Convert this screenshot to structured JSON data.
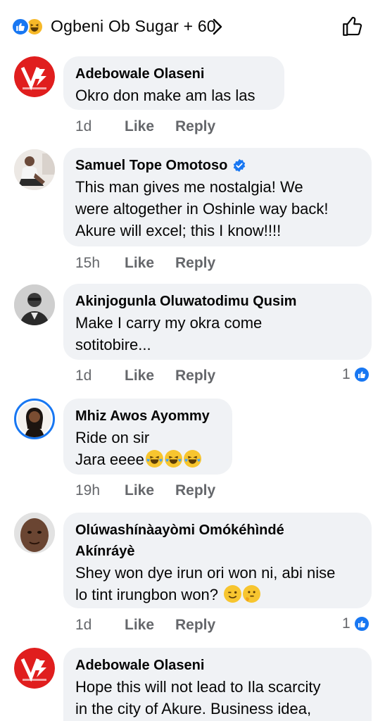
{
  "header": {
    "title": "Ogbeni Ob Sugar + 60",
    "reaction_icons": [
      "like-icon",
      "haha-icon"
    ],
    "chevron_icon": "chevron-right-icon",
    "action_icon": "thumbs-up-outline-icon"
  },
  "colors": {
    "accent": "#1877f2",
    "bubble": "#f0f2f5",
    "secondary_text": "#65676b",
    "emoji_yellow": "#f7c52f"
  },
  "comments": [
    {
      "author": "Adebowale Olaseni",
      "lines": [
        "Okro don make am las las"
      ],
      "time": "1d",
      "like": "Like",
      "reply": "Reply"
    },
    {
      "author": "Samuel Tope Omotoso",
      "verified": true,
      "lines": [
        "This man gives me nostalgia! We",
        "were altogether in Oshinle way back!",
        "Akure will excel; this I know!!!!"
      ],
      "time": "15h",
      "like": "Like",
      "reply": "Reply"
    },
    {
      "author": "Akinjogunla Oluwatodimu Qusim",
      "lines": [
        "Make I carry my okra come",
        "sotitobire..."
      ],
      "time": "1d",
      "like": "Like",
      "reply": "Reply",
      "reaction_count": "1"
    },
    {
      "author": "Mhiz Awos Ayommy",
      "lines": [
        "Ride on sir",
        "Jara eeee"
      ],
      "emojis": [
        "laughing-crying-emoji",
        "laughing-crying-emoji",
        "laughing-crying-emoji"
      ],
      "time": "19h",
      "like": "Like",
      "reply": "Reply"
    },
    {
      "author_lines": [
        "Olúwashínàayòmi Omókéhìndé",
        "Akínráyè"
      ],
      "lines": [
        "Shey won dye irun ori won ni, abi nise",
        "lo tint irungbon won?"
      ],
      "emojis": [
        "winking-emoji",
        "thinking-emoji"
      ],
      "time": "1d",
      "like": "Like",
      "reply": "Reply",
      "reaction_count": "1"
    },
    {
      "author": "Adebowale Olaseni",
      "lines": [
        "Hope this will not lead to Ila scarcity",
        "in the city of Akure. Business idea,"
      ]
    }
  ]
}
